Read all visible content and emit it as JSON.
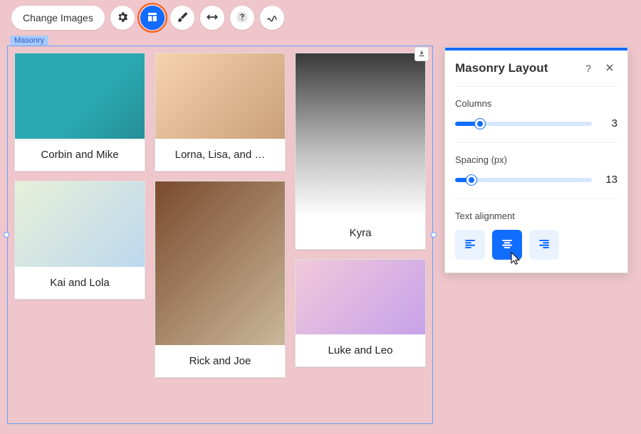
{
  "toolbar": {
    "change_images_label": "Change Images"
  },
  "gallery": {
    "selection_label": "Masonry",
    "cards": [
      {
        "caption": "Corbin and Mike"
      },
      {
        "caption": "Kai and Lola"
      },
      {
        "caption": "Lorna, Lisa, and …"
      },
      {
        "caption": "Rick and Joe"
      },
      {
        "caption": "Kyra"
      },
      {
        "caption": "Luke and Leo"
      }
    ]
  },
  "panel": {
    "title": "Masonry Layout",
    "columns": {
      "label": "Columns",
      "value": 3,
      "fill_pct": 18
    },
    "spacing": {
      "label": "Spacing (px)",
      "value": 13,
      "fill_pct": 12
    },
    "alignment": {
      "label": "Text alignment",
      "selected": "center"
    }
  }
}
